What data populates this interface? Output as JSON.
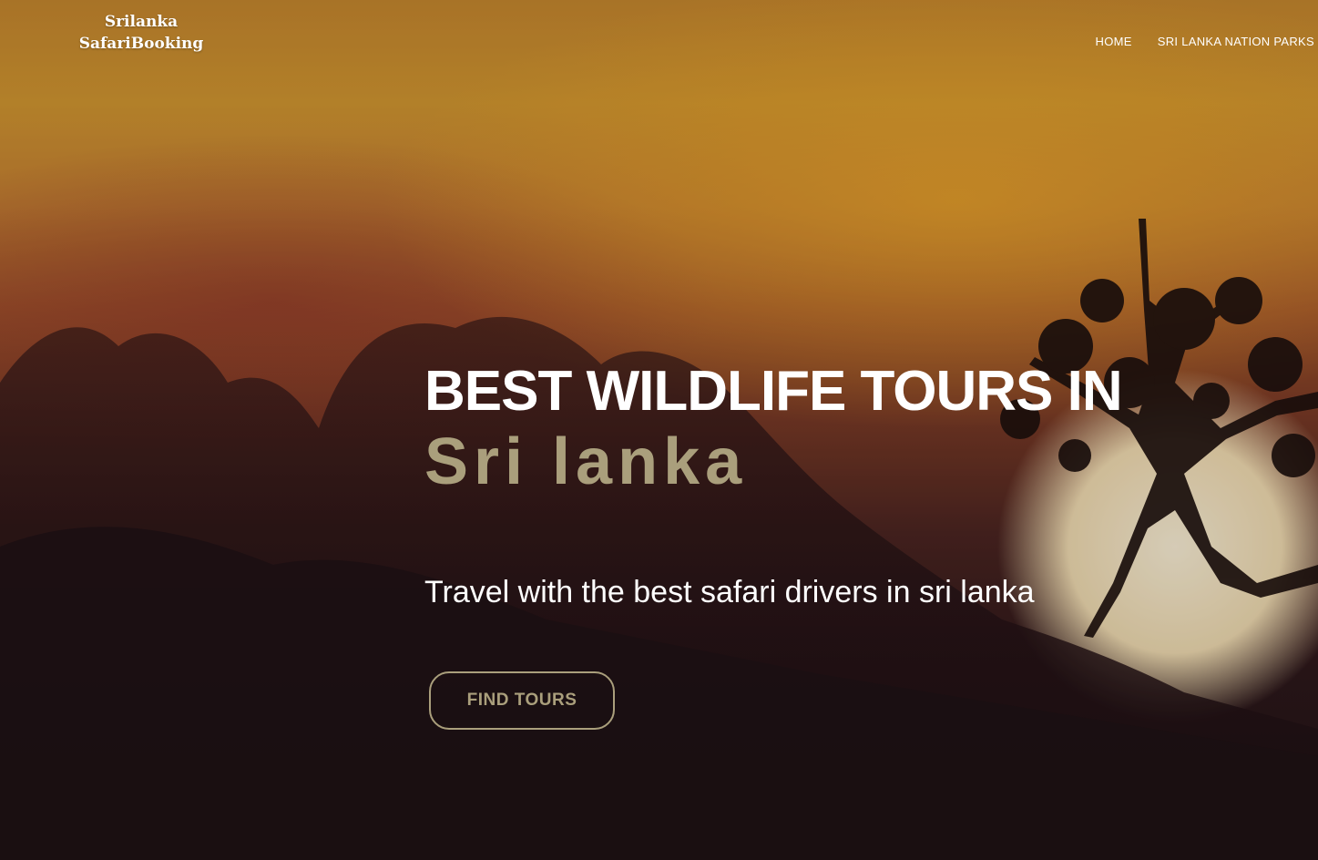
{
  "brand": {
    "line1": "Srilanka",
    "line2": "SafariBooking"
  },
  "nav": {
    "items": [
      {
        "label": "HOME"
      },
      {
        "label": "SRI LANKA NATION PARKS"
      }
    ]
  },
  "hero": {
    "headline": "BEST WILDLIFE TOURS IN",
    "sub_headline": "Sri lanka",
    "tagline": "Travel with the best safari drivers in sri lanka",
    "cta_label": "FIND TOURS",
    "background_image": "sunset-savanna-tree-silhouette",
    "colors": {
      "accent": "#aa9f7c",
      "text": "#ffffff"
    }
  }
}
